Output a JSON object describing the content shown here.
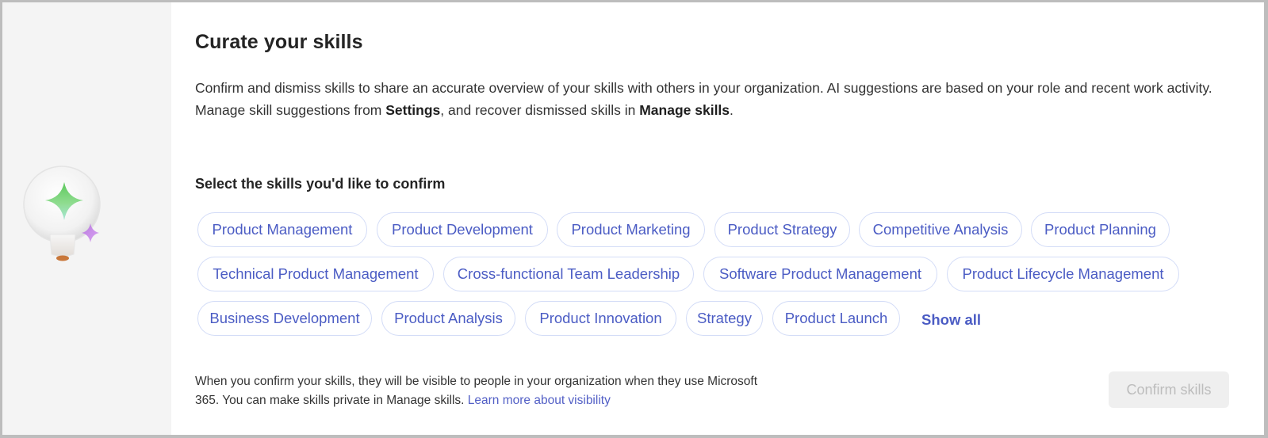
{
  "page": {
    "title": "Curate your skills",
    "description": {
      "part1": "Confirm and dismiss skills to share an accurate overview of your skills with others in your organization. AI suggestions are based on your role and recent work activity. Manage skill suggestions from ",
      "settings_label": "Settings",
      "part2": ", and recover dismissed skills in ",
      "manage_skills_label": "Manage skills",
      "part3": "."
    },
    "section_label": "Select the skills you'd like to confirm",
    "skills": [
      "Product Management",
      "Product Development",
      "Product Marketing",
      "Product Strategy",
      "Competitive Analysis",
      "Product Planning",
      "Technical Product Management",
      "Cross-functional Team Leadership",
      "Software Product Management",
      "Product Lifecycle Management",
      "Business Development",
      "Product Analysis",
      "Product Innovation",
      "Strategy",
      "Product Launch"
    ],
    "show_all_label": "Show all",
    "footer": {
      "note": "When you confirm your skills, they will be visible to people in your organization when they use Microsoft 365. You can make skills private in Manage skills. ",
      "link_label": "Learn more about visibility"
    },
    "confirm_button_label": "Confirm skills",
    "confirm_button_enabled": false
  },
  "illustration": {
    "icon": "lightbulb-sparkle-icon"
  },
  "colors": {
    "chip_text": "#4b5cc4",
    "chip_border": "#d3dcf7",
    "link": "#5360c6",
    "left_panel_bg": "#f4f4f4",
    "disabled_button_bg": "#efefef",
    "disabled_button_text": "#bdbdbd",
    "sparkle_green": "#6fcf6f",
    "sparkle_purple": "#c27be0"
  }
}
